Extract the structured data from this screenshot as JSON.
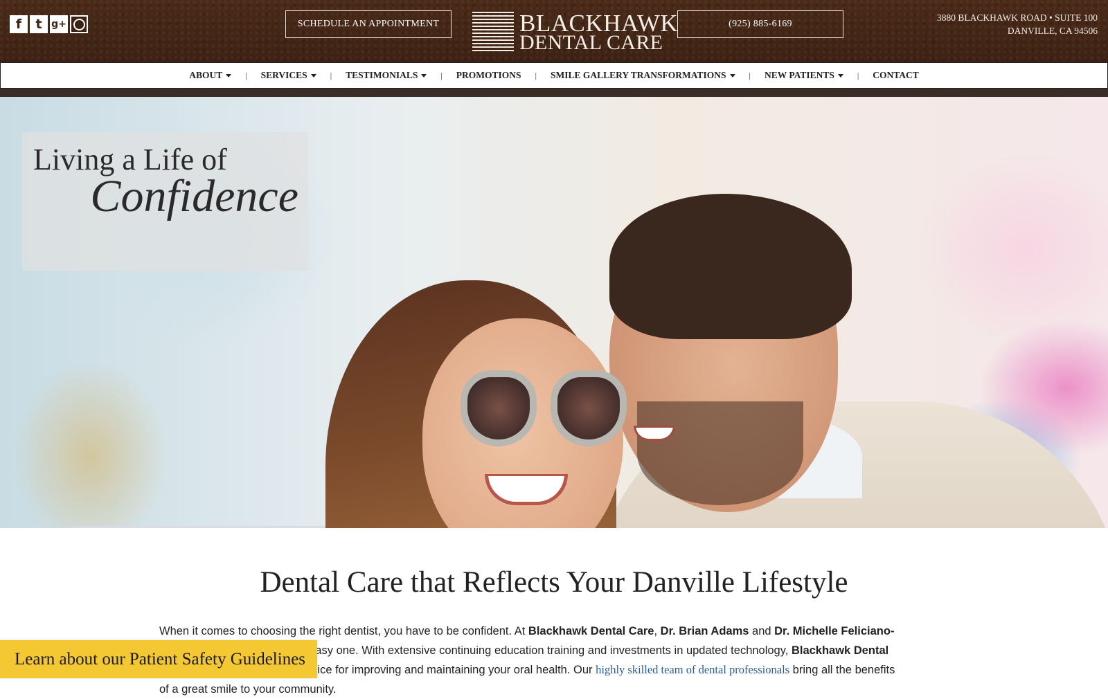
{
  "header": {
    "social": [
      {
        "name": "facebook-icon",
        "glyph": "f"
      },
      {
        "name": "tumblr-icon",
        "glyph": "t"
      },
      {
        "name": "google-plus-icon",
        "glyph": "g+"
      },
      {
        "name": "instagram-icon",
        "glyph": ""
      }
    ],
    "appointment_label": "SCHEDULE AN APPOINTMENT",
    "phone_label": "(925) 885-6169",
    "logo": {
      "line1": "BLACKHAWK",
      "line2": "DENTAL CARE"
    },
    "address": {
      "line1": "3880 Blackhawk Road • Suite 100",
      "line2": "Danville, CA 94506"
    }
  },
  "nav": {
    "items": [
      {
        "label": "About",
        "dropdown": true
      },
      {
        "label": "Services",
        "dropdown": true
      },
      {
        "label": "Testimonials",
        "dropdown": true
      },
      {
        "label": "Promotions",
        "dropdown": false
      },
      {
        "label": "Smile Gallery Transformations",
        "dropdown": true
      },
      {
        "label": "New Patients",
        "dropdown": true
      },
      {
        "label": "Contact",
        "dropdown": false
      }
    ],
    "separator": "|"
  },
  "hero": {
    "line1": "Living a Life of",
    "line2": "Confidence"
  },
  "main": {
    "heading": "Dental Care that Reflects Your Danville Lifestyle",
    "intro": {
      "t1": "When it comes to choosing the right dentist, you have to be confident. At ",
      "b1": "Blackhawk Dental Care",
      "t2": ", ",
      "b2": "Dr. Brian Adams",
      "t3": " and ",
      "b3": "Dr. Michelle Feliciano-Turner",
      "t4": " make the decision an easy one. With extensive continuing education training and investments in updated technology, ",
      "b4": "Blackhawk Dental Care",
      "t5": " becomes the obvious choice for improving and maintaining your oral health. Our ",
      "link": "highly skilled team of dental professionals",
      "t6": " bring all the benefits of a great smile to your community."
    }
  },
  "safety_banner": "Learn about our Patient Safety Guidelines",
  "colors": {
    "header_bg": "#3d2213",
    "banner": "#f3c832",
    "link": "#2a5d9a"
  }
}
